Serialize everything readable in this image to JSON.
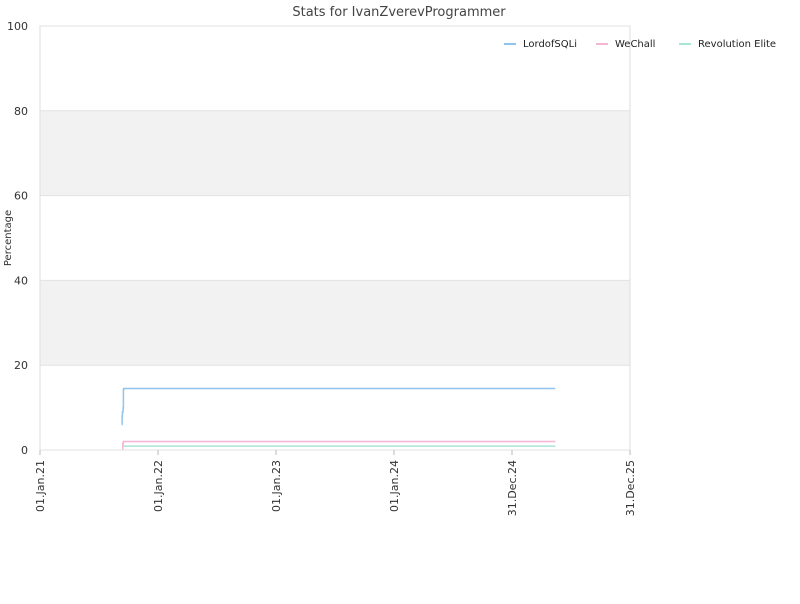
{
  "chart_data": {
    "type": "line",
    "title": "Stats for IvanZverevProgrammer",
    "xlabel": "",
    "ylabel": "Percentage",
    "xlim": [
      "2021-01-01",
      "2025-12-31"
    ],
    "ylim": [
      0,
      100
    ],
    "x_ticks": [
      "01.Jan.21",
      "01.Jan.22",
      "01.Jan.23",
      "01.Jan.24",
      "31.Dec.24",
      "31.Dec.25"
    ],
    "x_tick_dates": [
      "2021-01-01",
      "2022-01-01",
      "2023-01-01",
      "2024-01-01",
      "2024-12-31",
      "2025-12-31"
    ],
    "y_ticks": [
      0,
      20,
      40,
      60,
      80,
      100
    ],
    "alternating_bands": true,
    "legend_position": "top-right",
    "series": [
      {
        "name": "LordofSQLi",
        "color": "#90c4ee",
        "points": [
          [
            "2021-09-11",
            6
          ],
          [
            "2021-09-12",
            8
          ],
          [
            "2021-09-13",
            9
          ],
          [
            "2021-09-15",
            10
          ],
          [
            "2021-09-16",
            14.3
          ],
          [
            "2021-09-17",
            14.5
          ],
          [
            "2025-05-14",
            14.5
          ]
        ]
      },
      {
        "name": "WeChall",
        "color": "#f4b6d4",
        "points": [
          [
            "2021-09-13",
            0.2
          ],
          [
            "2021-09-14",
            1.5
          ],
          [
            "2021-09-16",
            2.0
          ],
          [
            "2025-05-14",
            2.0
          ]
        ]
      },
      {
        "name": "Revolution Elite",
        "color": "#a8e6d8",
        "points": [
          [
            "2021-09-16",
            0.9
          ],
          [
            "2025-05-14",
            0.9
          ]
        ]
      }
    ]
  }
}
